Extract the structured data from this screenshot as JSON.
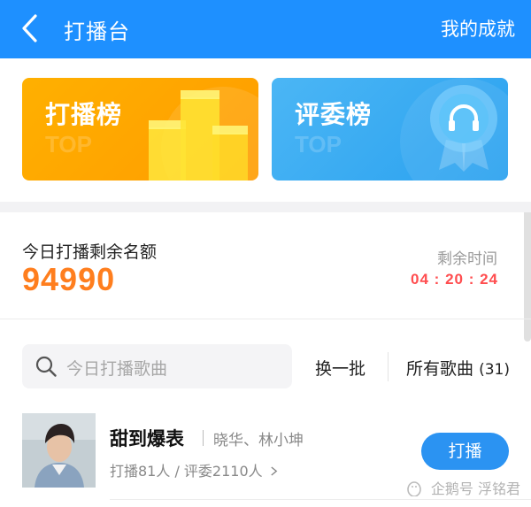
{
  "header": {
    "title": "打播台",
    "right_link": "我的成就",
    "background": "#1e90ff"
  },
  "banners": [
    {
      "label": "打播榜",
      "deco": "TOP",
      "color": "#ffa800"
    },
    {
      "label": "评委榜",
      "deco": "TOP",
      "color": "#35abf2"
    }
  ],
  "quota": {
    "label": "今日打播剩余名额",
    "value": "94990",
    "remain_label": "剩余时间",
    "remain_value": "04 : 20 : 24"
  },
  "search": {
    "placeholder": "今日打播歌曲",
    "refresh_label": "换一批",
    "all_songs_label": "所有歌曲",
    "all_songs_count": "(31)"
  },
  "songs": [
    {
      "title": "甜到爆表",
      "artists": "晓华、林小坤",
      "stats": "打播81人 / 评委2110人",
      "action": "打播"
    }
  ],
  "watermark": "企鹅号 浮铭君"
}
